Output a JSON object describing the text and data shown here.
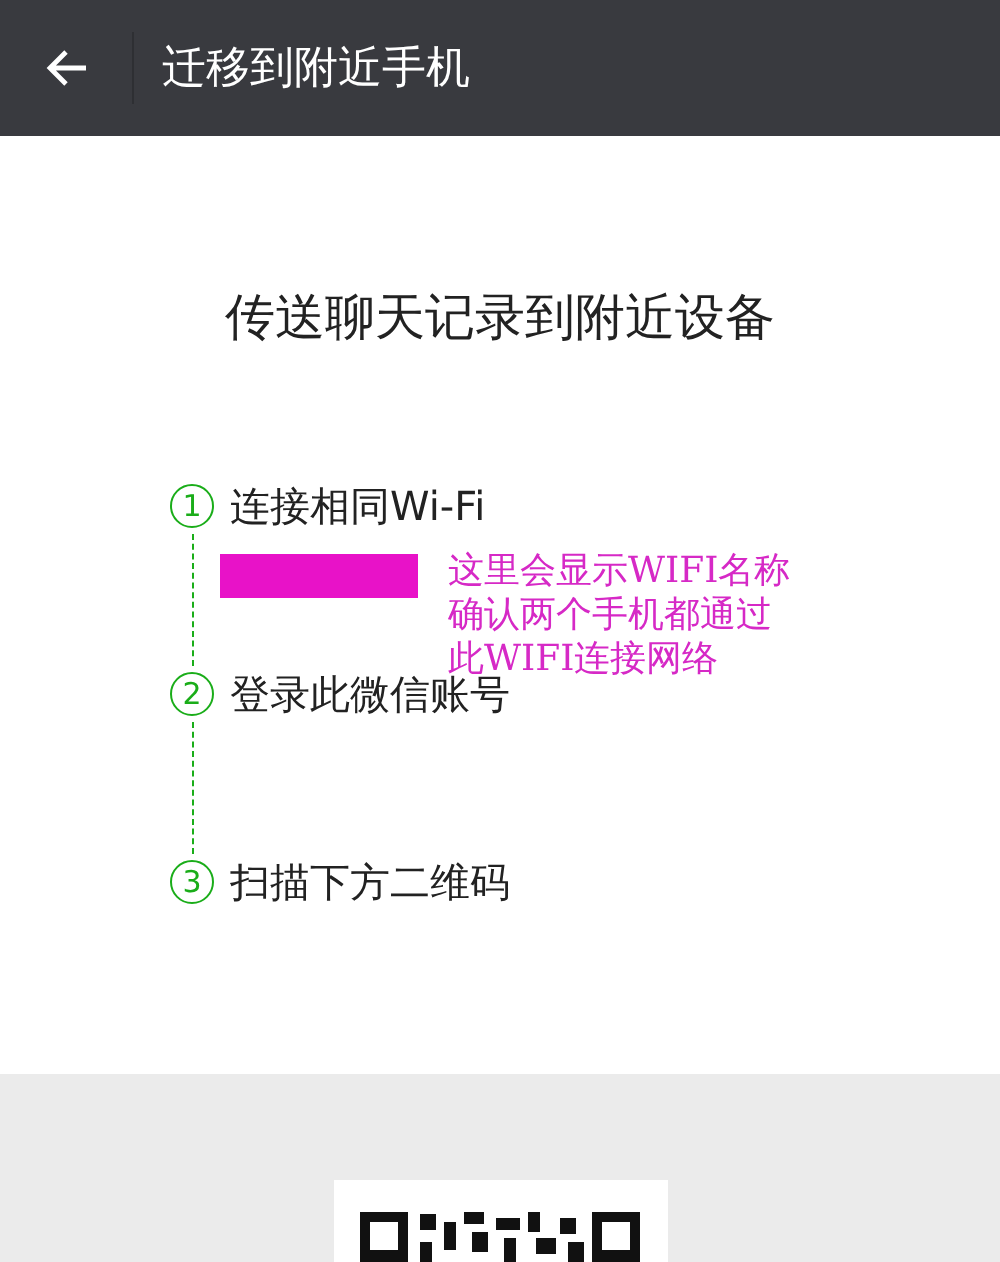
{
  "header": {
    "title": "迁移到附近手机"
  },
  "heading": "传送聊天记录到附近设备",
  "steps": [
    {
      "number": "1",
      "label": "连接相同Wi-Fi"
    },
    {
      "number": "2",
      "label": "登录此微信账号"
    },
    {
      "number": "3",
      "label": "扫描下方二维码"
    }
  ],
  "annotation": [
    "这里会显示WIFI名称",
    "确认两个手机都通过",
    "此WIFI连接网络"
  ]
}
